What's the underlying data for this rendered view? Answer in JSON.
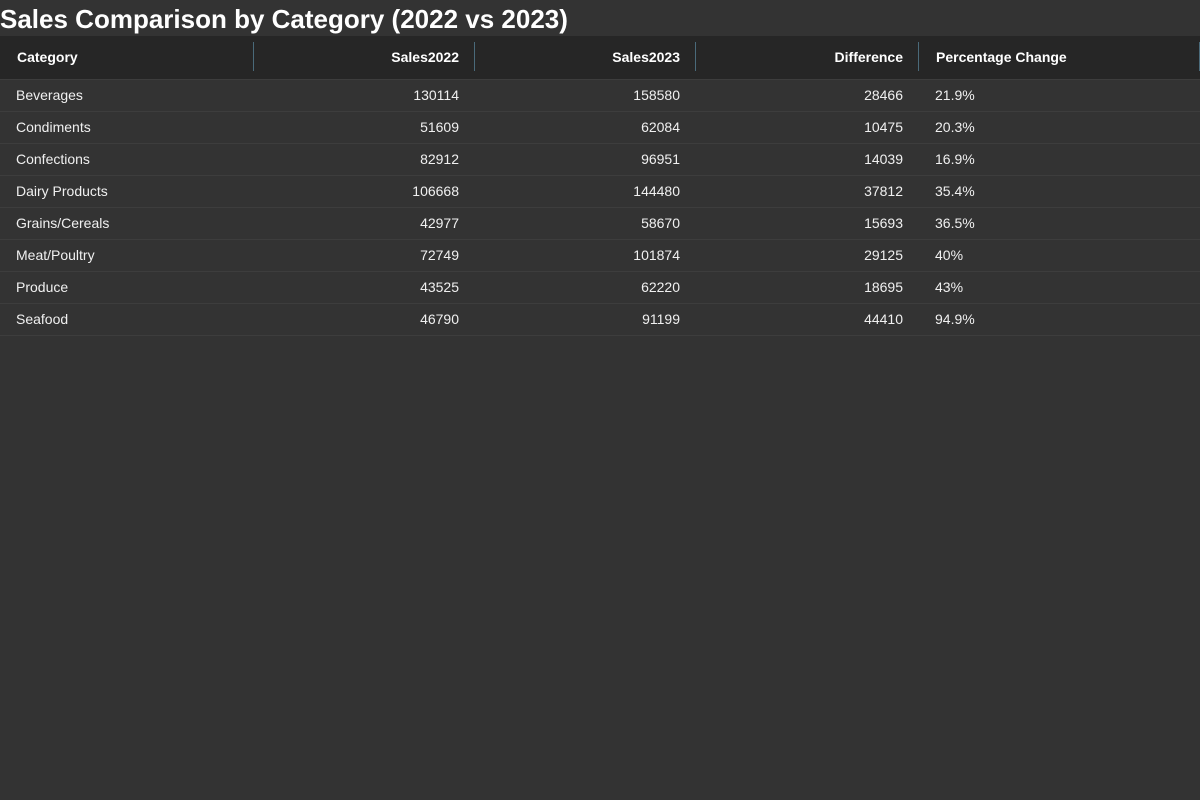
{
  "page": {
    "title": "Sales Comparison by Category (2022 vs 2023)"
  },
  "table": {
    "columns": [
      {
        "label": "Category",
        "align": "left"
      },
      {
        "label": "Sales2022",
        "align": "right"
      },
      {
        "label": "Sales2023",
        "align": "right"
      },
      {
        "label": "Difference",
        "align": "right"
      },
      {
        "label": "Percentage Change",
        "align": "left"
      }
    ],
    "rows": [
      {
        "category": "Beverages",
        "sales2022": "130114",
        "sales2023": "158580",
        "difference": "28466",
        "pct": "21.9%"
      },
      {
        "category": "Condiments",
        "sales2022": "51609",
        "sales2023": "62084",
        "difference": "10475",
        "pct": "20.3%"
      },
      {
        "category": "Confections",
        "sales2022": "82912",
        "sales2023": "96951",
        "difference": "14039",
        "pct": "16.9%"
      },
      {
        "category": "Dairy Products",
        "sales2022": "106668",
        "sales2023": "144480",
        "difference": "37812",
        "pct": "35.4%"
      },
      {
        "category": "Grains/Cereals",
        "sales2022": "42977",
        "sales2023": "58670",
        "difference": "15693",
        "pct": "36.5%"
      },
      {
        "category": "Meat/Poultry",
        "sales2022": "72749",
        "sales2023": "101874",
        "difference": "29125",
        "pct": "40%"
      },
      {
        "category": "Produce",
        "sales2022": "43525",
        "sales2023": "62220",
        "difference": "18695",
        "pct": "43%"
      },
      {
        "category": "Seafood",
        "sales2022": "46790",
        "sales2023": "91199",
        "difference": "44410",
        "pct": "94.9%"
      }
    ]
  },
  "colors": {
    "background": "#333333",
    "header_background": "#262626",
    "column_separator": "#4a6a7a",
    "text": "#f0f0f0"
  }
}
